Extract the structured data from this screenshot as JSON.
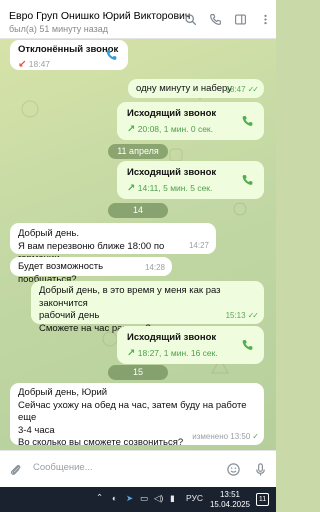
{
  "header": {
    "contact_name": "Евро Груп Онишко Юрий Викторович",
    "status": "был(а) 51 минуту назад"
  },
  "messages": [
    {
      "type": "call",
      "direction": "in",
      "title": "Отклонённый звонок",
      "time": "18:47"
    },
    {
      "type": "text",
      "direction": "out",
      "text": "одну минуту и наберу",
      "time": "18:47"
    },
    {
      "type": "call",
      "direction": "out",
      "title": "Исходящий звонок",
      "meta": "20:08, 1 мин. 0 сек."
    },
    {
      "type": "date",
      "label": "11 апреля"
    },
    {
      "type": "call",
      "direction": "out",
      "title": "Исходящий звонок",
      "meta": "14:11, 5 мин. 5 сек."
    },
    {
      "type": "date",
      "label": "14 апреля"
    },
    {
      "type": "text",
      "direction": "in",
      "lines": [
        "Добрый день.",
        "Я вам перезвоню ближе 18:00 по германии"
      ],
      "time": "14:27"
    },
    {
      "type": "text",
      "direction": "in",
      "text": "Будет возможность пообщаться?",
      "time": "14:28"
    },
    {
      "type": "text",
      "direction": "out",
      "lines": [
        "Добрый день, в это время у меня как раз закончится",
        "рабочий день",
        "Сможете на час раньше?"
      ],
      "time": "15:13"
    },
    {
      "type": "call",
      "direction": "out",
      "title": "Исходящий звонок",
      "meta": "18:27, 1 мин. 16 сек."
    },
    {
      "type": "date",
      "label": "15 апреля"
    },
    {
      "type": "text",
      "direction": "in",
      "lines": [
        "Добрый день, Юрий",
        "Сейчас ухожу на обед на час, затем буду на работе еще",
        "3-4 часа",
        "Во сколько вы сможете созвониться?"
      ],
      "time": "изменено 13:50"
    }
  ],
  "input": {
    "placeholder": "Сообщение..."
  },
  "taskbar": {
    "language": "РУС",
    "time": "13:51",
    "date": "15.04.2025",
    "notification_count": "11"
  },
  "icons": [
    "search-icon",
    "phone-icon",
    "sidebar-icon",
    "more-icon",
    "attach-icon",
    "emoji-icon",
    "mic-icon"
  ],
  "colors": {
    "accent": "#4fae4e",
    "declined": "#e3493e",
    "out_bubble": "#effdde",
    "chat_bg": "#c3d8a4"
  }
}
